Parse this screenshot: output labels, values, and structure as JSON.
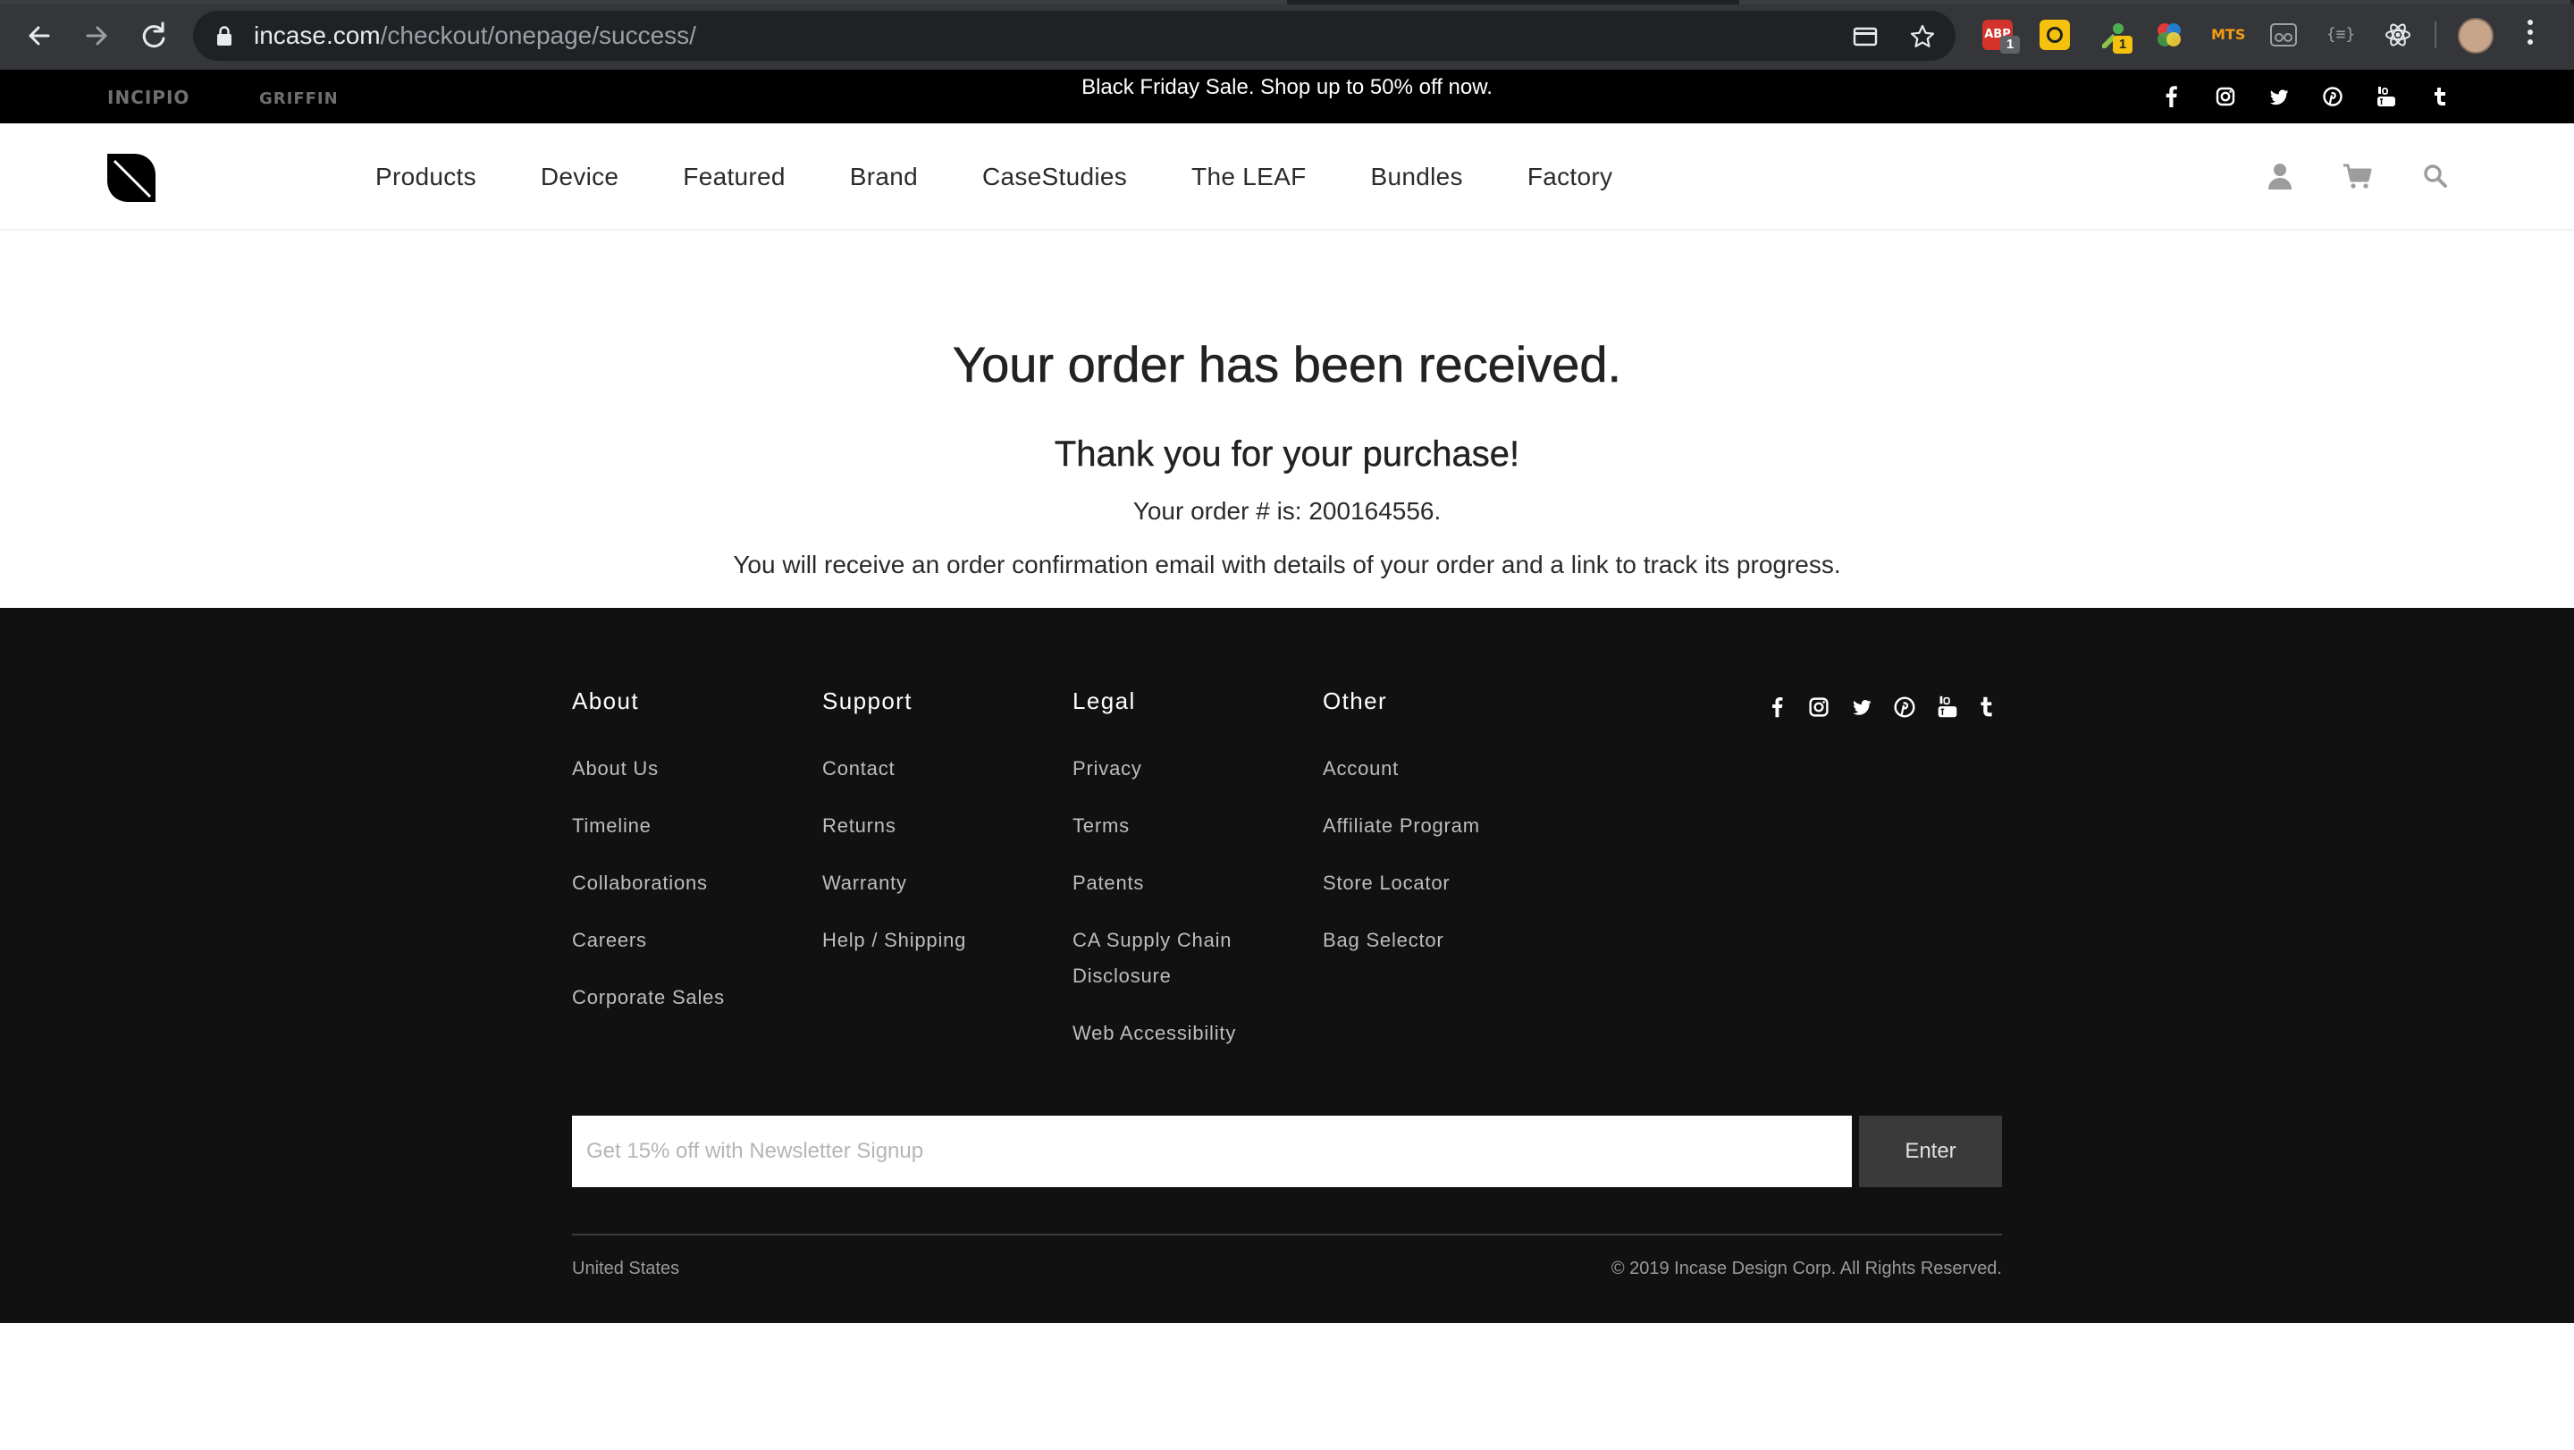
{
  "browser": {
    "url_host": "incase.com",
    "url_path": "/checkout/onepage/success/",
    "extensions": [
      {
        "name": "adblock-icon",
        "label": "ABP",
        "badge": "1",
        "color": "#d2332b"
      },
      {
        "name": "colorpick-icon",
        "label": "",
        "badge": "",
        "color": "#f4c20d"
      },
      {
        "name": "eyedropper-extension-icon",
        "label": "",
        "badge": "1",
        "color": "#f4c20d"
      },
      {
        "name": "colorwheel-icon",
        "label": "",
        "badge": "",
        "color": "#7a59c9"
      },
      {
        "name": "mts-icon",
        "label": "MTS",
        "badge": "",
        "color": "#f29b11"
      },
      {
        "name": "reader-icon",
        "label": "",
        "badge": "",
        "color": "#9aa0a6"
      },
      {
        "name": "json-icon",
        "label": "{≡}",
        "badge": "",
        "color": "#9aa0a6"
      },
      {
        "name": "react-devtools-icon",
        "label": "",
        "badge": "",
        "color": "#e8eaed"
      }
    ]
  },
  "promo": {
    "brand_incipio": "INCIPIO",
    "brand_griffin": "GRIFFIN",
    "message": "Black Friday Sale. Shop up to 50% off now."
  },
  "header": {
    "menu": [
      "Products",
      "Device",
      "Featured",
      "Brand",
      "CaseStudies",
      "The LEAF",
      "Bundles",
      "Factory"
    ]
  },
  "main": {
    "title": "Your order has been received.",
    "subtitle": "Thank you for your purchase!",
    "order_text": "Your order # is: 200164556.",
    "note": "You will receive an order confirmation email with details of your order and a link to track its progress."
  },
  "footer": {
    "columns": [
      {
        "title": "About",
        "links": [
          "About Us",
          "Timeline",
          "Collaborations",
          "Careers",
          "Corporate Sales"
        ]
      },
      {
        "title": "Support",
        "links": [
          "Contact",
          "Returns",
          "Warranty",
          "Help / Shipping"
        ]
      },
      {
        "title": "Legal",
        "links": [
          "Privacy",
          "Terms",
          "Patents",
          "CA Supply Chain",
          "Disclosure",
          "Web Accessibility"
        ]
      },
      {
        "title": "Other",
        "links": [
          "Account",
          "Affiliate Program",
          "Store Locator",
          "Bag Selector"
        ]
      }
    ],
    "newsletter_placeholder": "Get 15% off with Newsletter Signup",
    "enter_label": "Enter",
    "country": "United States",
    "copyright": "© 2019 Incase Design Corp. All Rights Reserved."
  }
}
